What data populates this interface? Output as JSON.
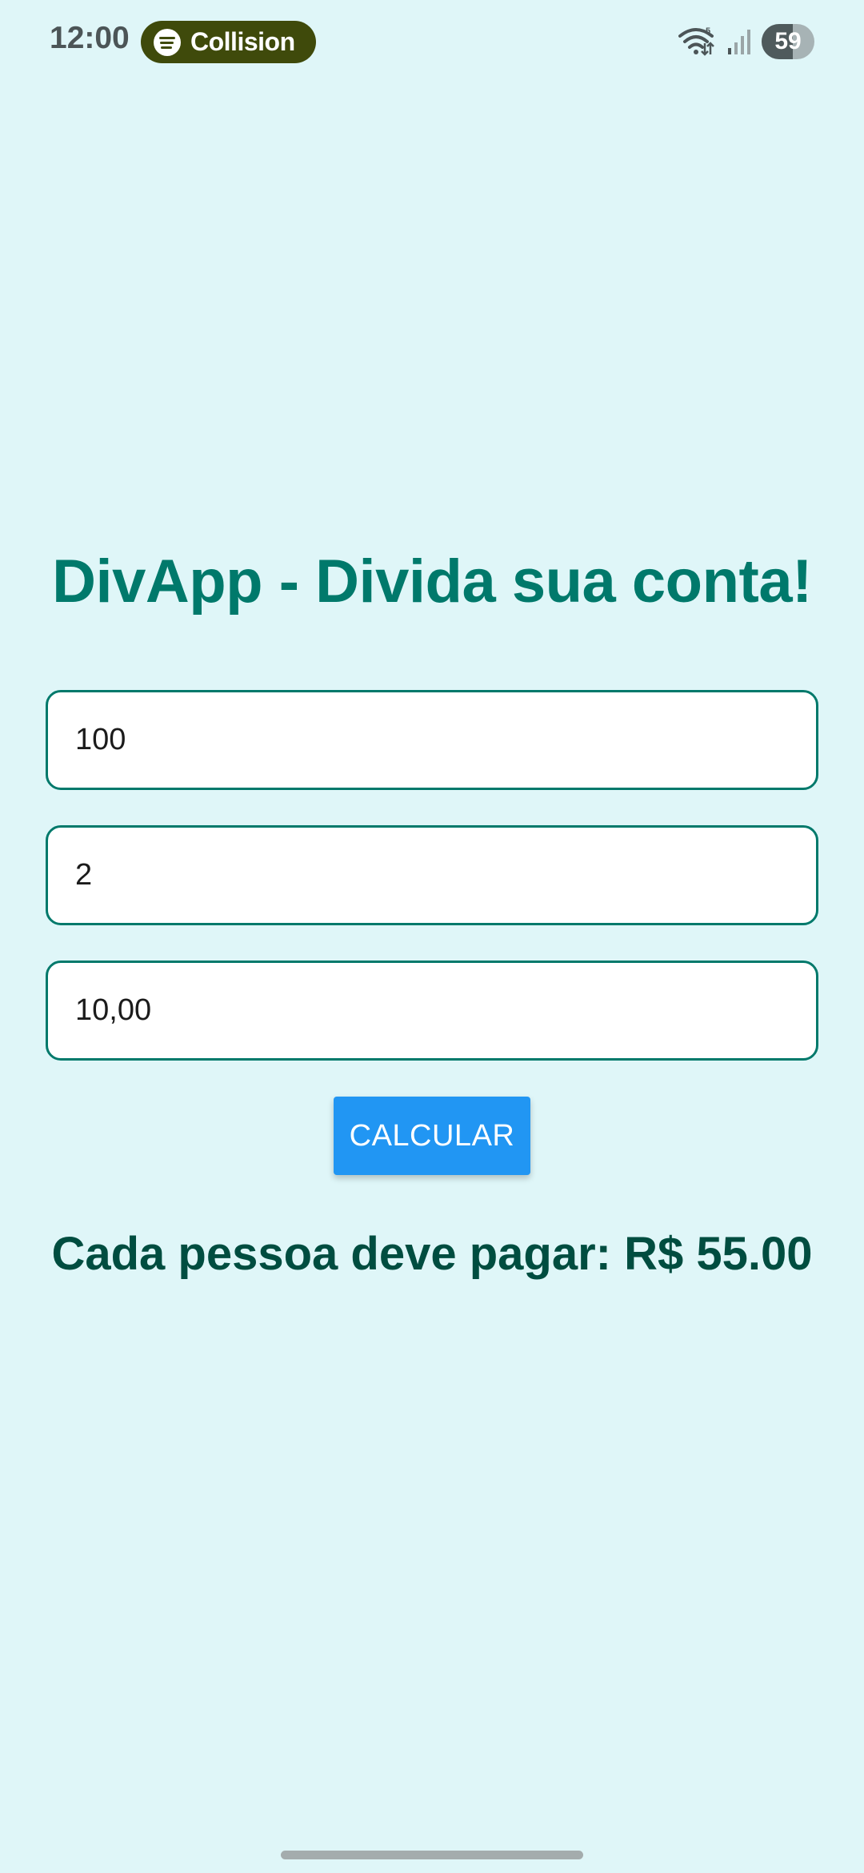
{
  "status_bar": {
    "time": "12:00",
    "media_chip_label": "Collision",
    "battery_level": "59",
    "battery_fraction": 0.59,
    "icons": [
      "spotify-icon",
      "wifi-icon",
      "signal-icon",
      "battery-icon"
    ]
  },
  "app": {
    "title": "DivApp - Divida sua conta!",
    "inputs": {
      "total_value": "100",
      "people_count": "2",
      "tip_value": "10,00"
    },
    "calculate_label": "CALCULAR",
    "result_text": "Cada pessoa deve pagar: R$ 55.00"
  },
  "colors": {
    "background": "#dff6f8",
    "title": "#00796b",
    "field_border": "#00796b",
    "button": "#2196f3",
    "result": "#004d40",
    "media_chip": "#3f4a0b"
  }
}
